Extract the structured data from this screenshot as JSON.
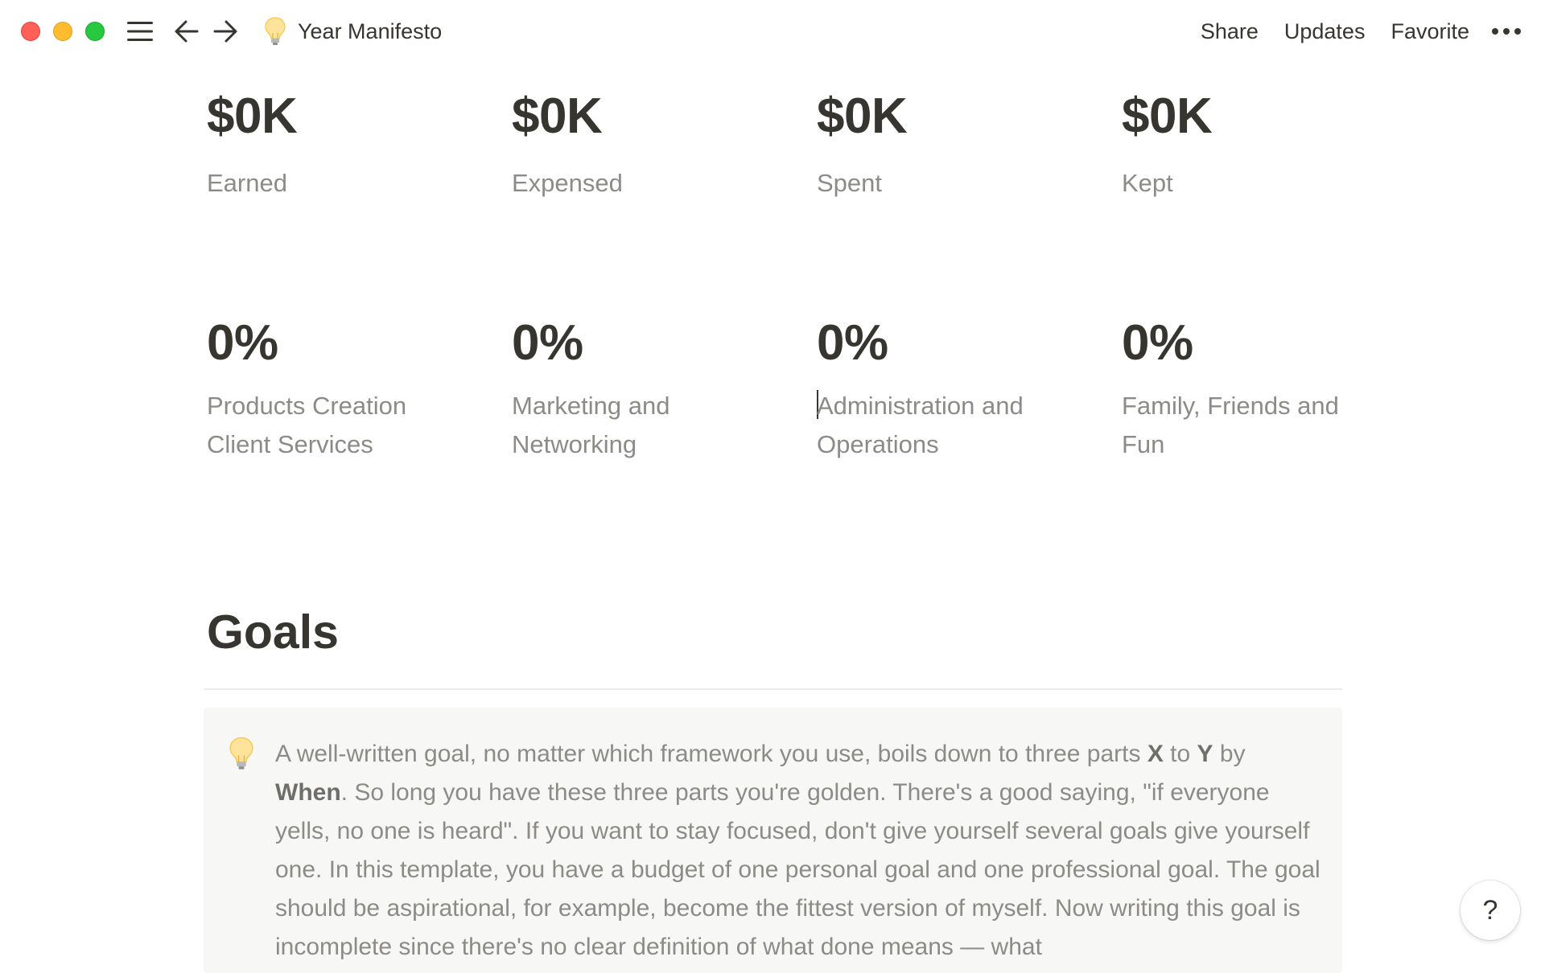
{
  "window": {
    "title": "Year Manifesto",
    "page_icon": "lightbulb-icon",
    "controls": [
      "close",
      "minimize",
      "maximize"
    ],
    "colors": {
      "close": "#fe5f57",
      "minimize": "#febc2e",
      "maximize": "#28c840"
    }
  },
  "topbar": {
    "share_label": "Share",
    "updates_label": "Updates",
    "favorite_label": "Favorite",
    "icons": [
      "menu-icon",
      "back-arrow-icon",
      "forward-arrow-icon",
      "more-icon"
    ]
  },
  "stats_money": [
    {
      "value": "$0K",
      "label": "Earned"
    },
    {
      "value": "$0K",
      "label": "Expensed"
    },
    {
      "value": "$0K",
      "label": "Spent"
    },
    {
      "value": "$0K",
      "label": "Kept"
    }
  ],
  "stats_percent": [
    {
      "value": "0%",
      "label": "Products Creation Client Services"
    },
    {
      "value": "0%",
      "label": "Marketing and Networking"
    },
    {
      "value": "0%",
      "label": "Administration and Operations"
    },
    {
      "value": "0%",
      "label": "Family, Friends and Fun"
    }
  ],
  "goals": {
    "heading": "Goals",
    "callout": {
      "icon": "lightbulb-icon",
      "t1": "A well-written goal, no matter which framework you use, boils down to three parts ",
      "x": "X",
      "t2": " to ",
      "y": "Y",
      "t3": " by ",
      "when": "When",
      "t4": ". So long you have these three parts you're golden. There's a good saying, \"if everyone yells, no one is heard\". If you want to stay focused, don't give yourself several goals give yourself one. In this template, you have a budget of one personal goal and one professional goal. The goal should be aspirational, for example, become the fittest version of myself. Now writing this goal is incomplete since there's no clear definition of what done means — what"
    }
  },
  "help": {
    "label": "?"
  },
  "theme": {
    "text": "#37352f",
    "muted": "#8c8b87",
    "callout_bg": "#f7f7f5",
    "divider": "#ebebea"
  }
}
